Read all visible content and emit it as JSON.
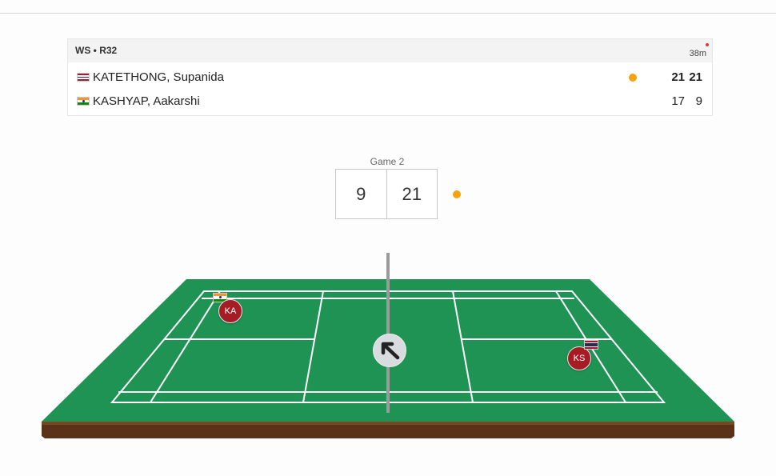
{
  "match": {
    "event": "WS • R32",
    "duration": "38m",
    "players": [
      {
        "name": "KATETHONG, Supanida",
        "country": "Thailand",
        "games": [
          "21",
          "21"
        ],
        "winner": true,
        "serving": true
      },
      {
        "name": "KASHYAP, Aakarshi",
        "country": "India",
        "games": [
          "17",
          "9"
        ],
        "winner": false,
        "serving": false
      }
    ]
  },
  "game": {
    "label": "Game 2",
    "left_score": "9",
    "right_score": "21"
  },
  "court": {
    "left_player_initials": "KA",
    "right_player_initials": "KS",
    "shuttle_direction": "up-left"
  },
  "colors": {
    "court_green": "#1f9354",
    "court_side": "#0f7a43",
    "court_base": "#5a3218",
    "serve_dot": "#f5a210",
    "player_token": "#a51c24",
    "net": "#9a9a9a"
  },
  "icons": {
    "serve_indicator": "circle-dot",
    "shuttle_direction": "arrow-up-left-icon"
  }
}
